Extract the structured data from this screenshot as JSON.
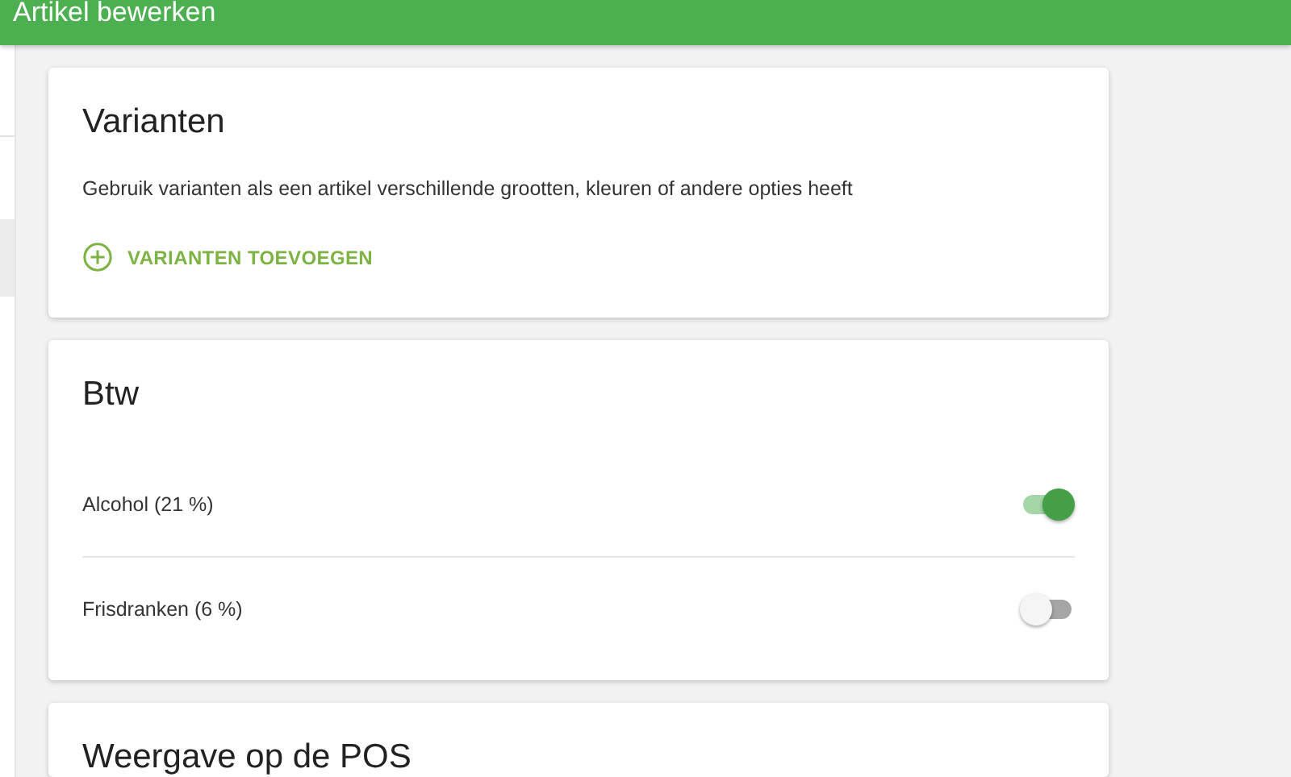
{
  "header": {
    "title": "Artikel bewerken"
  },
  "variants": {
    "title": "Varianten",
    "description": "Gebruik varianten als een artikel verschillende grootten, kleuren of andere opties heeft",
    "add_button": "VARIANTEN TOEVOEGEN"
  },
  "vat": {
    "title": "Btw",
    "rates": [
      {
        "label": "Alcohol (21 %)",
        "on": true
      },
      {
        "label": "Frisdranken (6 %)",
        "on": false
      }
    ]
  },
  "display": {
    "title": "Weergave op de POS"
  }
}
